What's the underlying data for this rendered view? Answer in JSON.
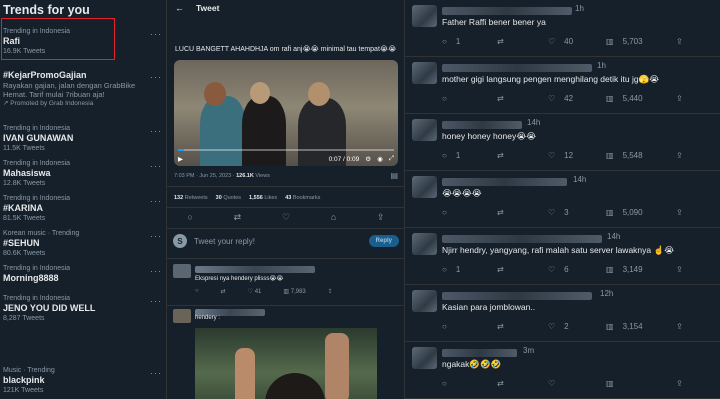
{
  "trends": {
    "title": "Trends for you",
    "items": [
      {
        "context": "Trending in Indonesia",
        "name": "Rafi",
        "count": "16.9K Tweets"
      },
      {
        "context": "Trending in Indonesia",
        "name": "IVAN GUNAWAN",
        "count": "11.5K Tweets"
      },
      {
        "context": "Trending in Indonesia",
        "name": "Mahasiswa",
        "count": "12.8K Tweets"
      },
      {
        "context": "Trending in Indonesia",
        "name": "#KARINA",
        "count": "81.5K Tweets"
      },
      {
        "context": "Korean music · Trending",
        "name": "#SEHUN",
        "count": "80.6K Tweets"
      },
      {
        "context": "Trending in Indonesia",
        "name": "Morning8888",
        "count": ""
      },
      {
        "context": "Trending in Indonesia",
        "name": "JENO YOU DID WELL",
        "count": "8,287 Tweets"
      },
      {
        "context": "Music · Trending",
        "name": "blackpink",
        "count": "121K Tweets"
      }
    ],
    "promo": {
      "name": "#KejarPromoGajian",
      "desc": "Rayakan gajian, jalan dengan GrabBike Hemat. Tarif mulai 7ribuan aja!",
      "by": "Promoted by Grab Indonesia"
    }
  },
  "tweet": {
    "header": "Tweet",
    "text": "LUCU BANGETT AHAHDHJA om rafi anj😭😭 minimal tau tempat😭😭",
    "video_time": "0:07 / 0:09",
    "timestamp": "7:03 PM · Jun 25, 2023 · ",
    "views_count": "126.1K",
    "views_label": "Views",
    "retweets": "132",
    "retweets_label": "Retweets",
    "quotes": "30",
    "quotes_label": "Quotes",
    "likes": "1,556",
    "likes_label": "Likes",
    "bookmarks": "43",
    "bookmarks_label": "Bookmarks",
    "reply_placeholder": "Tweet your reply!",
    "reply_button": "Reply",
    "replies": [
      {
        "text": "Ekspresi nya hendery plisss😭😭",
        "likes": "41",
        "views": "7,983"
      },
      {
        "text": "hendery :"
      }
    ]
  },
  "comments": [
    {
      "time": "1h",
      "text": "Father Raffi bener bener ya",
      "replies": "1",
      "retweets": "",
      "likes": "40",
      "views": "5,703"
    },
    {
      "time": "1h",
      "text": "mother gigi langsung pengen menghilang detik itu jg🫣😭",
      "replies": "",
      "retweets": "",
      "likes": "42",
      "views": "5,440"
    },
    {
      "time": "14h",
      "text": "honey honey honey😭😭",
      "replies": "1",
      "retweets": "",
      "likes": "12",
      "views": "5,548"
    },
    {
      "time": "14h",
      "text": "😭😭😭😭",
      "replies": "",
      "retweets": "",
      "likes": "3",
      "views": "5,090"
    },
    {
      "time": "14h",
      "text": "Njirr hendry, yangyang, rafi malah satu server lawaknya ☝️😭",
      "replies": "1",
      "retweets": "",
      "likes": "6",
      "views": "3,149"
    },
    {
      "time": "12h",
      "text": "Kasian para jomblowan..",
      "replies": "",
      "retweets": "",
      "likes": "2",
      "views": "3,154"
    },
    {
      "time": "3m",
      "text": "ngakak🤣🤣🤣",
      "replies": "",
      "retweets": "",
      "likes": "",
      "views": ""
    }
  ]
}
